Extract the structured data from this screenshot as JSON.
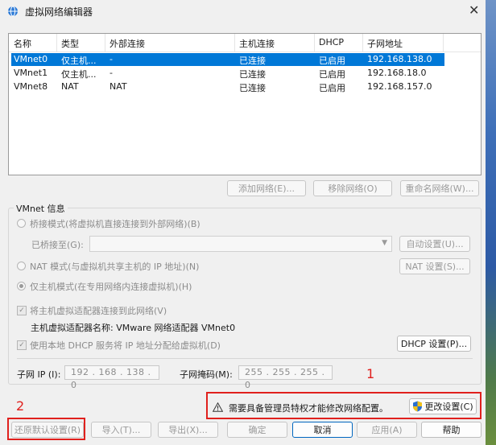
{
  "window": {
    "title": "虚拟网络编辑器",
    "app_icon": "network-globe-icon",
    "close_icon": "close-icon"
  },
  "table": {
    "headers": [
      "名称",
      "类型",
      "外部连接",
      "主机连接",
      "DHCP",
      "子网地址"
    ],
    "rows": [
      [
        "VMnet0",
        "仅主机...",
        "-",
        "已连接",
        "已启用",
        "192.168.138.0"
      ],
      [
        "VMnet1",
        "仅主机...",
        "-",
        "已连接",
        "已启用",
        "192.168.18.0"
      ],
      [
        "VMnet8",
        "NAT",
        "NAT",
        "已连接",
        "已启用",
        "192.168.157.0"
      ]
    ],
    "selected_row": 0
  },
  "table_buttons": {
    "add": "添加网络(E)...",
    "remove": "移除网络(O)",
    "rename": "重命名网络(W)..."
  },
  "vmnet_info": {
    "label": "VMnet 信息",
    "bridge_mode": "桥接模式(将虚拟机直接连接到外部网络)(B)",
    "bridged_to_label": "已桥接至(G):",
    "bridged_to_value": "",
    "auto_settings": "自动设置(U)...",
    "nat_mode": "NAT 模式(与虚拟机共享主机的 IP 地址)(N)",
    "nat_settings": "NAT 设置(S)...",
    "host_only_mode": "仅主机模式(在专用网络内连接虚拟机)(H)",
    "connect_adapter": "将主机虚拟适配器连接到此网络(V)",
    "adapter_name": "主机虚拟适配器名称: VMware 网络适配器 VMnet0",
    "use_dhcp": "使用本地 DHCP 服务将 IP 地址分配给虚拟机(D)",
    "dhcp_settings": "DHCP 设置(P)...",
    "subnet_ip_label": "子网 IP (I):",
    "subnet_ip": "192 . 168 . 138 . 0",
    "subnet_mask_label": "子网掩码(M):",
    "subnet_mask": "255 . 255 . 255 . 0"
  },
  "admin_notice": {
    "text": "需要具备管理员特权才能修改网络配置。",
    "icon": "warning-icon",
    "button": "更改设置(C)",
    "button_icon": "uac-shield-icon"
  },
  "bottom_buttons": {
    "restore": "还原默认设置(R)",
    "import": "导入(T)...",
    "export": "导出(X)...",
    "ok": "确定",
    "cancel": "取消",
    "apply": "应用(A)",
    "help": "帮助"
  },
  "annotations": {
    "label1": "1",
    "label2": "2",
    "color": "#e0201d"
  },
  "colors": {
    "selection": "#0078d7"
  }
}
